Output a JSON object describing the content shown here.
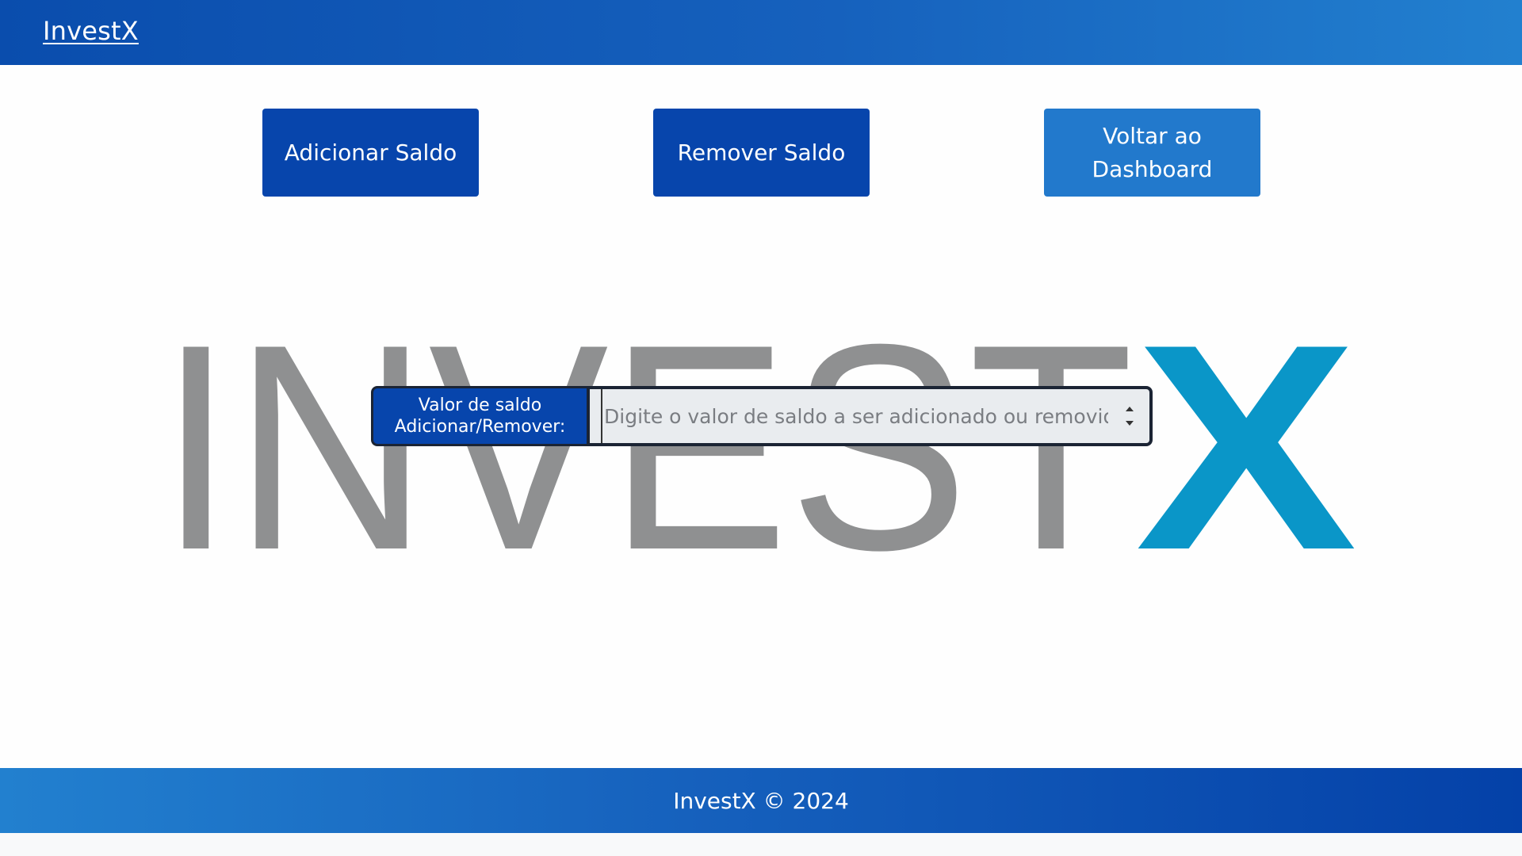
{
  "navbar": {
    "brand": "InvestX",
    "background_colors": [
      "#0a4dad",
      "#2280cf"
    ]
  },
  "actions": {
    "add_balance": "Adicionar Saldo",
    "remove_balance": "Remover Saldo",
    "back_line1": "Voltar ao",
    "back_line2": "Dashboard"
  },
  "hero_logo": {
    "text_gray": "INVEST",
    "text_accent": "X",
    "gray_color": "#8f9091",
    "accent_color": "#0a96c8"
  },
  "form": {
    "label_line1": "Valor de saldo",
    "label_line2": "Adicionar/Remover:",
    "placeholder": "Digite o valor de saldo a ser adicionado ou removido",
    "value": ""
  },
  "footer": {
    "text": "InvestX © 2024"
  },
  "colors": {
    "primary_button": "#0745ac",
    "secondary_button": "#2279cc",
    "input_background": "#e9ecef"
  }
}
